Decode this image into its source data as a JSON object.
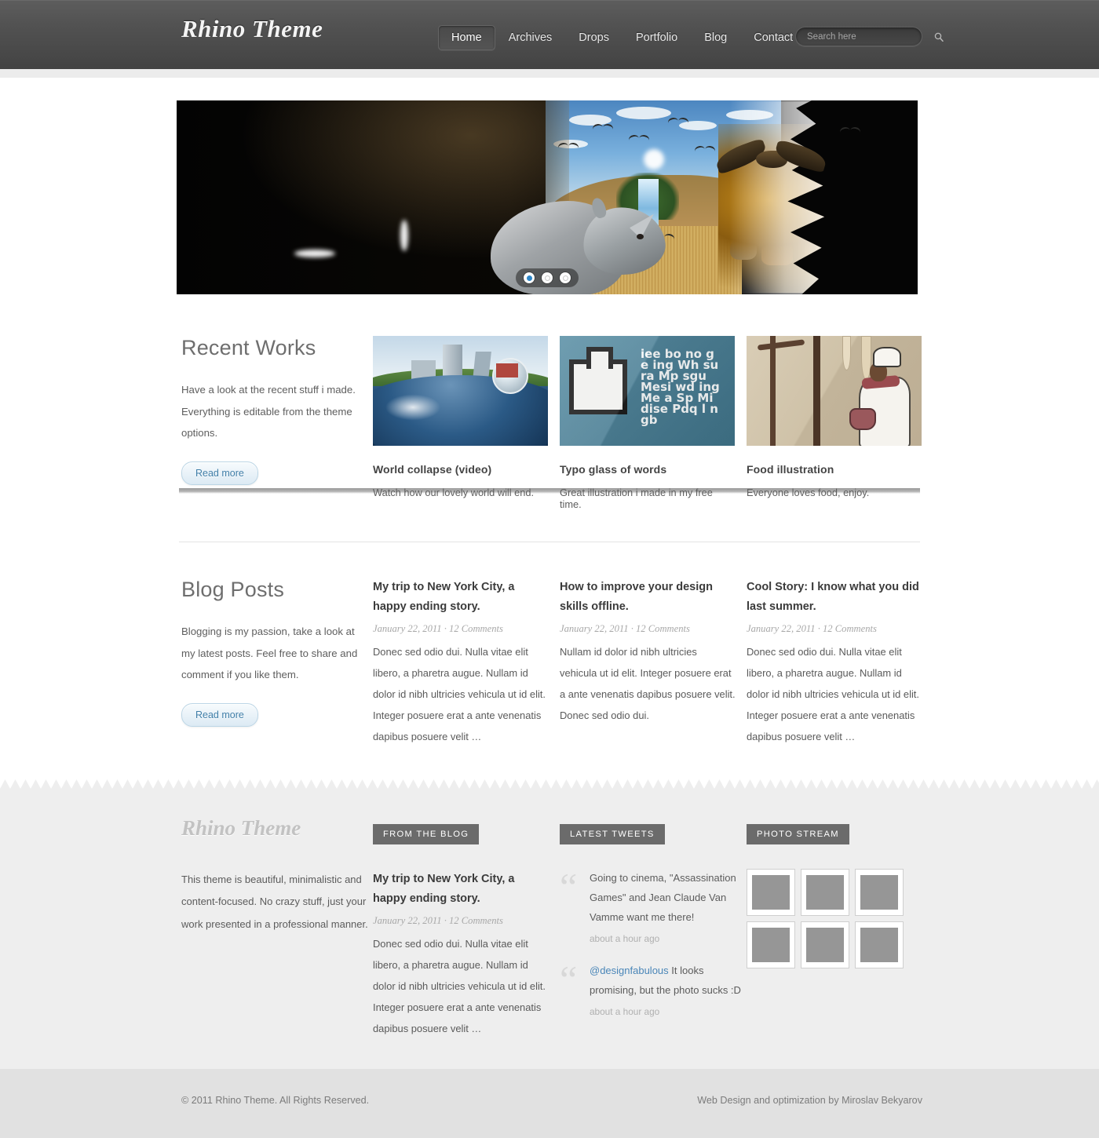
{
  "header": {
    "logo": "Rhino Theme",
    "nav": [
      {
        "label": "Home",
        "active": true
      },
      {
        "label": "Archives",
        "active": false
      },
      {
        "label": "Drops",
        "active": false
      },
      {
        "label": "Portfolio",
        "active": false
      },
      {
        "label": "Blog",
        "active": false
      },
      {
        "label": "Contact",
        "active": false
      }
    ],
    "search": {
      "placeholder": "Search here",
      "value": "",
      "icon": "search-icon"
    }
  },
  "slider": {
    "alt": "Rhino surrounded by shattering savanna landscape composite",
    "dots": [
      "1",
      "2",
      "3"
    ],
    "active_dot": 1
  },
  "recent_works": {
    "title": "Recent Works",
    "description": "Have a look at the recent stuff i made. Everything is editable from the theme options.",
    "read_more": "Read more",
    "items": [
      {
        "title": "World collapse (video)",
        "desc": "Watch how our lovely world will end."
      },
      {
        "title": "Typo glass of words",
        "desc": "Great illustration i made in my free time."
      },
      {
        "title": "Food illustration",
        "desc": "Everyone loves food, enjoy."
      }
    ],
    "typo_words": "iee bo no ge ing Wh su ra Mp sgu Mesi wd ing Me a Sp Mi dise Pdq l n gb"
  },
  "blog_posts": {
    "title": "Blog Posts",
    "description": "Blogging is my passion, take a look at my latest posts. Feel free to  share and comment if you like them.",
    "read_more": "Read more",
    "items": [
      {
        "title": "My trip to New York City, a happy ending story.",
        "meta": "January 22, 2011 · 12 Comments",
        "body": "Donec sed odio dui. Nulla vitae elit libero, a pharetra augue. Nullam id dolor id nibh ultricies vehicula ut id elit. Integer posuere erat a ante venenatis dapibus posuere velit …"
      },
      {
        "title": "How to improve your design skills offline.",
        "meta": "January 22, 2011 · 12 Comments",
        "body": "Nullam id dolor id nibh ultricies vehicula ut id elit. Integer posuere erat a ante venenatis dapibus posuere velit. Donec sed odio dui."
      },
      {
        "title": "Cool Story: I know what you did last summer.",
        "meta": "January 22, 2011 · 12 Comments",
        "body": "Donec sed odio dui. Nulla vitae elit libero, a pharetra augue. Nullam id dolor id nibh ultricies vehicula ut id elit. Integer posuere erat a ante venenatis dapibus posuere velit …"
      }
    ]
  },
  "footer": {
    "about": {
      "title": "Rhino Theme",
      "text": "This theme is beautiful, minimalistic and content-focused. No crazy stuff, just your work presented in a professional manner."
    },
    "from_the_blog": {
      "badge": "FROM THE BLOG",
      "post": {
        "title": "My trip to New York City, a happy ending story.",
        "meta": "January 22, 2011 · 12 Comments",
        "body": "Donec sed odio dui. Nulla vitae elit libero, a pharetra augue. Nullam id dolor id nibh ultricies vehicula ut id elit. Integer posuere erat a ante venenatis dapibus posuere velit …"
      }
    },
    "latest_tweets": {
      "badge": "LATEST TWEETS",
      "items": [
        {
          "handle": "",
          "text": "Going to cinema, \"Assassination Games\" and Jean Claude Van Vamme want me there!",
          "time": "about a hour ago"
        },
        {
          "handle": "@designfabulous",
          "text": " It looks promising, but the photo sucks :D",
          "time": "about a hour ago"
        }
      ]
    },
    "photo_stream": {
      "badge": "PHOTO STREAM",
      "count": 6
    },
    "bottom": {
      "copyright": "© 2011 Rhino Theme. All Rights Reserved.",
      "credit": "Web Design and optimization by Miroslav Bekyarov"
    }
  },
  "colors": {
    "header_bg": "#4d4d4d",
    "accent_blue": "#2e86c8",
    "footer_bg": "#eeeeee",
    "footer_bottom_bg": "#e1e1e1",
    "badge_bg": "#6b6b6b",
    "link_blue": "#4a86b8"
  }
}
